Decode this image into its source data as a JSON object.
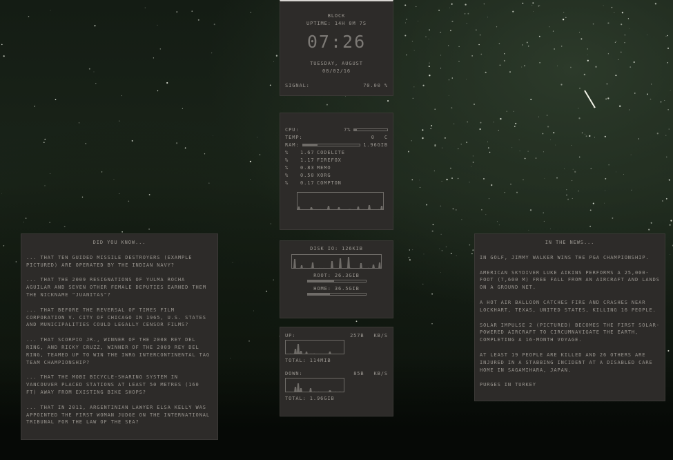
{
  "clock": {
    "title": "BLOCK",
    "uptime": "UPTIME: 14H 0M 7S",
    "time": "07:26",
    "day": "TUESDAY, AUGUST",
    "date": "08/02/16",
    "signal_label": "SIGNAL:",
    "signal_value": "70.00 %"
  },
  "system": {
    "cpu_label": "CPU:",
    "cpu_value": "7%",
    "cpu_fraction": 0.07,
    "temp_label": "TEMP:",
    "temp_value": "0",
    "temp_unit": "C",
    "ram_label": "RAM:",
    "ram_value": "1.96GIB",
    "ram_fraction": 0.25,
    "processes": [
      {
        "mark": "%",
        "value": "1.67",
        "name": "CODELITE"
      },
      {
        "mark": "%",
        "value": "1.17",
        "name": "FIREFOX"
      },
      {
        "mark": "%",
        "value": "0.83",
        "name": "MEMO"
      },
      {
        "mark": "%",
        "value": "0.50",
        "name": "XORG"
      },
      {
        "mark": "%",
        "value": "0.17",
        "name": "COMPTON"
      }
    ]
  },
  "disk": {
    "io_label": "DISK IO: 126KIB",
    "root_label": "ROOT: 26.3GIB",
    "root_fraction": 0.45,
    "home_label": "HOME: 36.5GIB",
    "home_fraction": 0.38
  },
  "network": {
    "up_label": "UP:",
    "up_value": "257B",
    "up_unit": "KB/S",
    "up_total": "TOTAL: 114MIB",
    "down_label": "DOWN:",
    "down_value": "85B",
    "down_unit": "KB/S",
    "down_total": "TOTAL: 1.96GIB"
  },
  "did_you_know": {
    "heading": "DID YOU KNOW...",
    "items": [
      "... THAT TEN GUIDED MISSILE DESTROYERS (EXAMPLE PICTURED) ARE OPERATED BY THE INDIAN NAVY?",
      "... THAT THE 2009 RESIGNATIONS OF YULMA ROCHA AGUILAR AND SEVEN OTHER FEMALE DEPUTIES EARNED THEM THE NICKNAME \"JUANITAS\"?",
      "... THAT BEFORE THE REVERSAL OF TIMES FILM CORPORATION V. CITY OF CHICAGO IN 1965, U.S. STATES AND MUNICIPALITIES COULD LEGALLY CENSOR FILMS?",
      "... THAT SCORPIO JR., WINNER OF THE 2008 REY DEL RING, AND RICKY CRUZZ, WINNER OF THE 2009 REY DEL RING, TEAMED UP TO WIN THE IWRG INTERCONTINENTAL TAG TEAM CHAMPIONSHIP?",
      "... THAT THE MOBI BICYCLE-SHARING SYSTEM IN VANCOUVER PLACED STATIONS AT LEAST 50 METRES (160 FT) AWAY FROM EXISTING BIKE SHOPS?",
      "... THAT IN 2011, ARGENTINIAN LAWYER ELSA KELLY WAS APPOINTED THE FIRST WOMAN JUDGE ON THE INTERNATIONAL TRIBUNAL FOR THE LAW OF THE SEA?"
    ]
  },
  "in_the_news": {
    "heading": "IN THE NEWS...",
    "items": [
      "IN GOLF, JIMMY WALKER WINS THE PGA CHAMPIONSHIP.",
      "AMERICAN SKYDIVER LUKE AIKINS PERFORMS A 25,000-FOOT (7,600 M) FREE FALL FROM AN AIRCRAFT AND LANDS ON A GROUND NET.",
      "A HOT AIR BALLOON CATCHES FIRE AND CRASHES NEAR LOCKHART, TEXAS, UNITED STATES, KILLING 16 PEOPLE.",
      "SOLAR IMPULSE 2 (PICTURED) BECOMES THE FIRST SOLAR-POWERED AIRCRAFT TO CIRCUMNAVIGATE THE EARTH, COMPLETING A 16-MONTH VOYAGE.",
      "AT LEAST 19 PEOPLE ARE KILLED AND 26 OTHERS ARE INJURED IN A STABBING INCIDENT AT A DISABLED CARE HOME IN SAGAMIHARA, JAPAN.",
      "PURGES IN TURKEY"
    ]
  },
  "colors": {
    "panel": "#2d2b29",
    "text": "#9a9690",
    "graph": "#6f6c68"
  }
}
